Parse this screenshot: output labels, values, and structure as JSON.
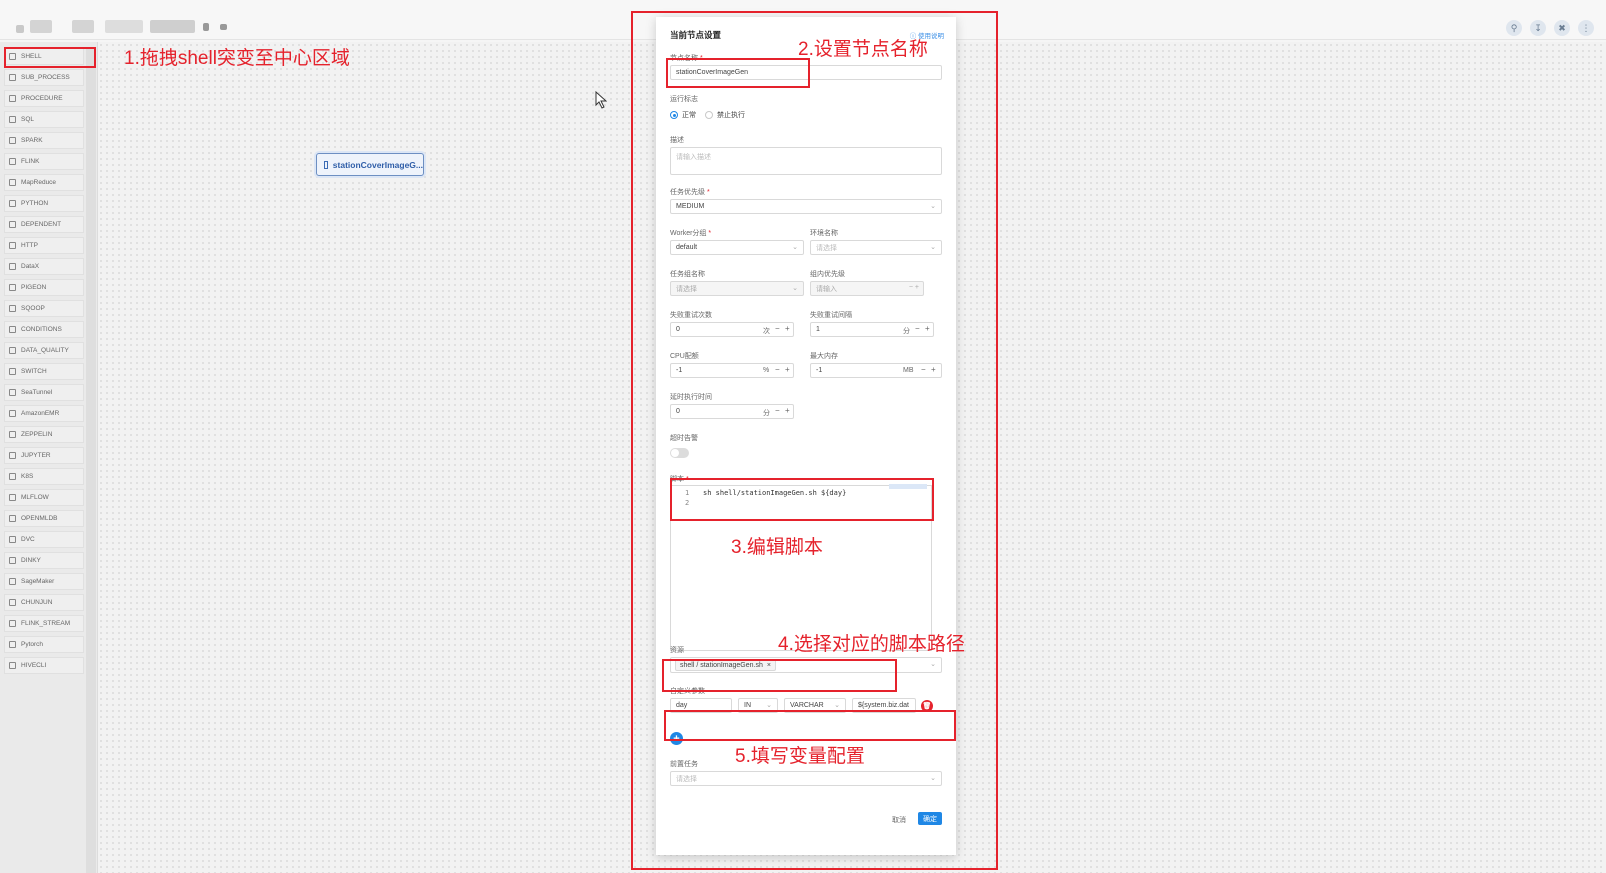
{
  "toolbar": {
    "icons": [
      "search-icon",
      "download-icon",
      "delete-icon",
      "more-icon"
    ]
  },
  "sidebar": {
    "items": [
      {
        "label": "SHELL"
      },
      {
        "label": "SUB_PROCESS"
      },
      {
        "label": "PROCEDURE"
      },
      {
        "label": "SQL"
      },
      {
        "label": "SPARK"
      },
      {
        "label": "FLINK"
      },
      {
        "label": "MapReduce"
      },
      {
        "label": "PYTHON"
      },
      {
        "label": "DEPENDENT"
      },
      {
        "label": "HTTP"
      },
      {
        "label": "DataX"
      },
      {
        "label": "PIGEON"
      },
      {
        "label": "SQOOP"
      },
      {
        "label": "CONDITIONS"
      },
      {
        "label": "DATA_QUALITY"
      },
      {
        "label": "SWITCH"
      },
      {
        "label": "SeaTunnel"
      },
      {
        "label": "AmazonEMR"
      },
      {
        "label": "ZEPPELIN"
      },
      {
        "label": "JUPYTER"
      },
      {
        "label": "K8S"
      },
      {
        "label": "MLFLOW"
      },
      {
        "label": "OPENMLDB"
      },
      {
        "label": "DVC"
      },
      {
        "label": "DINKY"
      },
      {
        "label": "SageMaker"
      },
      {
        "label": "CHUNJUN"
      },
      {
        "label": "FLINK_STREAM"
      },
      {
        "label": "Pytorch"
      },
      {
        "label": "HIVECLI"
      }
    ]
  },
  "canvas": {
    "node_label": "stationCoverImageG..."
  },
  "annotations": {
    "step1": "1.拖拽shell突变至中心区域",
    "step2": "2.设置节点名称",
    "step3": "3.编辑脚本",
    "step4": "4.选择对应的脚本路径",
    "step5": "5.填写变量配置"
  },
  "modal": {
    "title": "当前节点设置",
    "help": "使用说明",
    "node_name": {
      "label": "节点名称",
      "value": "stationCoverImageGen"
    },
    "run_flag": {
      "label": "运行标志",
      "opt_normal": "正常",
      "opt_forbid": "禁止执行"
    },
    "description": {
      "label": "描述",
      "placeholder": "请输入描述"
    },
    "priority": {
      "label": "任务优先级",
      "value": "MEDIUM"
    },
    "worker_group": {
      "label": "Worker分组",
      "value": "default"
    },
    "env_name": {
      "label": "环境名称",
      "placeholder": "请选择"
    },
    "task_group": {
      "label": "任务组名称",
      "placeholder": "请选择"
    },
    "group_priority": {
      "label": "组内优先级",
      "placeholder": "请输入"
    },
    "retry_times": {
      "label": "失败重试次数",
      "value": "0",
      "unit": "次"
    },
    "retry_interval": {
      "label": "失败重试间隔",
      "value": "1",
      "unit": "分"
    },
    "cpu_quota": {
      "label": "CPU配额",
      "value": "-1",
      "unit": "%"
    },
    "max_memory": {
      "label": "最大内存",
      "value": "-1",
      "unit": "MB"
    },
    "delay_time": {
      "label": "延时执行时间",
      "value": "0",
      "unit": "分"
    },
    "timeout_alarm": {
      "label": "超时告警"
    },
    "script": {
      "label": "脚本",
      "lines": [
        "sh shell/stationImageGen.sh ${day}",
        ""
      ]
    },
    "resources": {
      "label": "资源",
      "tag": "shell / stationImageGen.sh"
    },
    "custom_params": {
      "label": "自定义参数",
      "prop": "day",
      "direct": "IN",
      "type": "VARCHAR",
      "value": "${system.biz.dat"
    },
    "pre_tasks": {
      "label": "前置任务",
      "placeholder": "请选择"
    },
    "cancel": "取消",
    "confirm": "确定"
  }
}
